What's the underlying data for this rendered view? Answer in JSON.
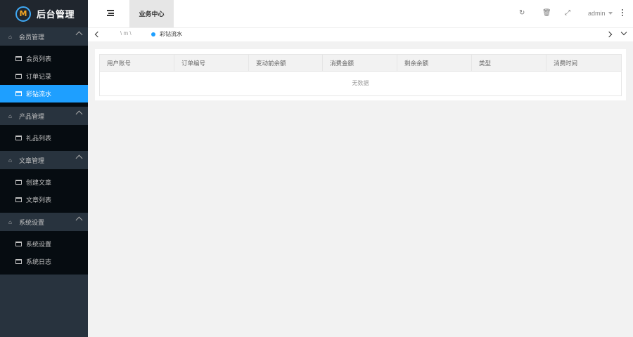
{
  "app": {
    "title": "后台管理",
    "logo_letter": "M"
  },
  "sidebar": {
    "groups": [
      {
        "label": "会员管理",
        "icon": "home-icon",
        "items": [
          {
            "label": "会员列表",
            "icon": "list-icon"
          },
          {
            "label": "订单记录",
            "icon": "calendar-icon"
          },
          {
            "label": "彩钻流水",
            "icon": "calendar-icon",
            "active": true
          }
        ]
      },
      {
        "label": "产品管理",
        "icon": "home-icon",
        "items": [
          {
            "label": "礼品列表",
            "icon": "list-icon"
          }
        ]
      },
      {
        "label": "文章管理",
        "icon": "home-icon",
        "items": [
          {
            "label": "创建文章",
            "icon": "list-icon"
          },
          {
            "label": "文章列表",
            "icon": "list-icon"
          }
        ]
      },
      {
        "label": "系统设置",
        "icon": "home-icon",
        "items": [
          {
            "label": "系统设置",
            "icon": "list-icon"
          },
          {
            "label": "系统日志",
            "icon": "list-icon"
          }
        ]
      }
    ]
  },
  "header": {
    "tab_label": "业务中心",
    "tools": [
      "refresh-icon",
      "trash-icon",
      "fullscreen-icon"
    ],
    "username": "admin",
    "accent": "#1e9fff"
  },
  "tabbar": {
    "home_label": "\\ m \\",
    "page_label": "彩钻流水"
  },
  "table": {
    "columns": [
      "用户账号",
      "订单编号",
      "变动前余额",
      "消费金额",
      "剩余余额",
      "类型",
      "消费时间"
    ],
    "empty_text": "无数据"
  }
}
